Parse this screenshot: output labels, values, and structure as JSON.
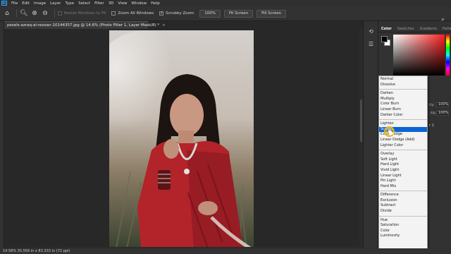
{
  "app": {
    "logo_text": "Ps"
  },
  "menu": [
    "File",
    "Edit",
    "Image",
    "Layer",
    "Type",
    "Select",
    "Filter",
    "3D",
    "View",
    "Window",
    "Help"
  ],
  "options_bar": {
    "resize_windows_to_fit": "Resize Windows to Fit",
    "zoom_all_windows": "Zoom All Windows",
    "scrubby_zoom": "Scrubby Zoom",
    "zoom_percent": "100%",
    "fit_screen": "Fit Screen",
    "fill_screen": "Fill Screen"
  },
  "document": {
    "tab_title": "pexels-azraq-al-rezoan-10144357.jpg @ 14.6% (Photo Filter 1, Layer Mask/8) *",
    "close_glyph": "×"
  },
  "status_bar": {
    "text": "14.58%  35.556 in x 83.333 in (72 ppi)"
  },
  "color_panel": {
    "tabs": [
      "Color",
      "Swatches",
      "Gradients",
      "Patterns"
    ],
    "active_tab": "Color"
  },
  "layers_panel": {
    "opacity_label": "ity:",
    "opacity_value": "100%",
    "fill_label": "Fill:",
    "fill_value": "100%",
    "layer_hint": "r 1"
  },
  "blend_modes": {
    "groups": [
      [
        "Normal",
        "Dissolve"
      ],
      [
        "Darken",
        "Multiply",
        "Color Burn",
        "Linear Burn",
        "Darker Color"
      ],
      [
        "Lighten",
        "Screen",
        "Color Dodge",
        "Linear Dodge (Add)",
        "Lighter Color"
      ],
      [
        "Overlay",
        "Soft Light",
        "Hard Light",
        "Vivid Light",
        "Linear Light",
        "Pin Light",
        "Hard Mix"
      ],
      [
        "Difference",
        "Exclusion",
        "Subtract",
        "Divide"
      ],
      [
        "Hue",
        "Saturation",
        "Color",
        "Luminosity"
      ]
    ],
    "selected": "Screen"
  },
  "colors": {
    "selection": "#0a64d2",
    "saree_red": "#b3232a",
    "panel_bg": "#323232"
  }
}
